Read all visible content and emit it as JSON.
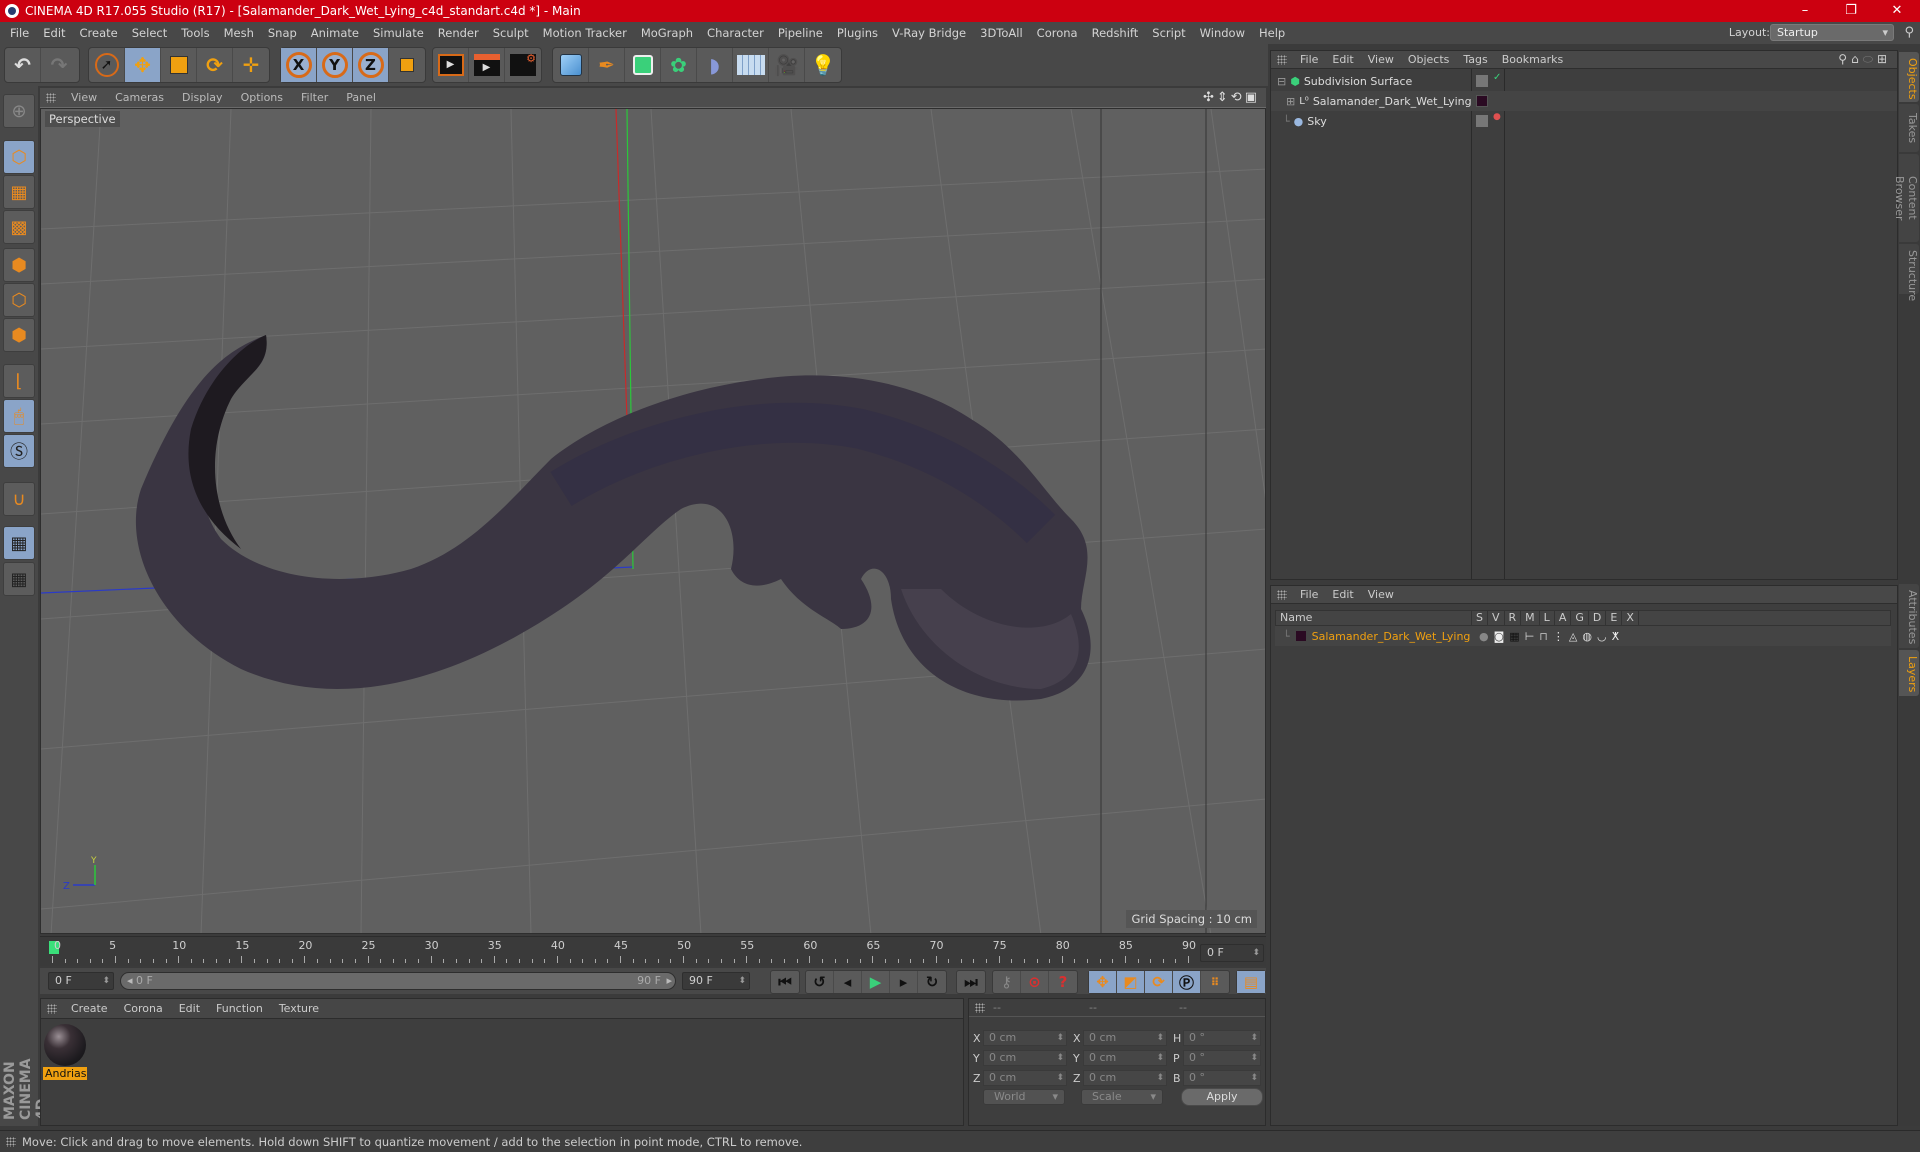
{
  "window": {
    "title": "CINEMA 4D R17.055 Studio (R17) - [Salamander_Dark_Wet_Lying_c4d_standart.c4d *] - Main",
    "controls": {
      "minimize": "–",
      "restore": "❐",
      "close": "✕"
    }
  },
  "menubar": {
    "items": [
      "File",
      "Edit",
      "Create",
      "Select",
      "Tools",
      "Mesh",
      "Snap",
      "Animate",
      "Simulate",
      "Render",
      "Sculpt",
      "Motion Tracker",
      "MoGraph",
      "Character",
      "Pipeline",
      "Plugins",
      "V-Ray Bridge",
      "3DToAll",
      "Corona",
      "Redshift",
      "Script",
      "Window",
      "Help"
    ],
    "layout_label": "Layout:",
    "layout_value": "Startup"
  },
  "toolbar": {
    "groups": [
      {
        "name": "history",
        "tools": [
          "undo-icon",
          "redo-icon"
        ]
      },
      {
        "name": "transform",
        "tools": [
          "live-select-icon",
          "move-icon",
          "scale-icon",
          "rotate-icon",
          "move-axis-icon"
        ]
      },
      {
        "name": "axis-lock",
        "tools": [
          "x-axis-icon",
          "y-axis-icon",
          "z-axis-icon",
          "coordinate-system-icon"
        ]
      },
      {
        "name": "render",
        "tools": [
          "render-view-icon",
          "render-picture-viewer-icon",
          "render-settings-icon"
        ]
      },
      {
        "name": "objects",
        "tools": [
          "cube-icon",
          "pen-spline-icon",
          "subdivision-surface-icon",
          "cloner-icon",
          "deformer-icon",
          "floor-icon",
          "camera-icon",
          "light-icon"
        ]
      }
    ],
    "axis_labels": [
      "X",
      "Y",
      "Z"
    ]
  },
  "left_toolbar": {
    "tools": [
      "make-editable-icon",
      "model-mode-icon",
      "texture-mode-icon",
      "workplane-icon",
      "points-mode-icon",
      "edges-mode-icon",
      "polygons-mode-icon",
      "enable-axis-icon",
      "tweak-mode-icon",
      "solo-icon",
      "snap-icon",
      "workplane-lock-icon",
      "workplane-rotate-icon"
    ],
    "branding": "MAXON CINEMA 4D"
  },
  "viewport": {
    "menu": [
      "View",
      "Cameras",
      "Display",
      "Options",
      "Filter",
      "Panel"
    ],
    "camera_label": "Perspective",
    "grid_spacing": "Grid Spacing : 10 cm",
    "nav_icons": [
      "move-view-icon",
      "zoom-view-icon",
      "rotate-view-icon",
      "maximize-view-icon"
    ],
    "axis_gizmo": {
      "y": "Y",
      "z": "Z"
    }
  },
  "timeline": {
    "ticks": [
      "0",
      "5",
      "10",
      "15",
      "20",
      "25",
      "30",
      "35",
      "40",
      "45",
      "50",
      "55",
      "60",
      "65",
      "70",
      "75",
      "80",
      "85",
      "90"
    ],
    "current_frame": "0 F",
    "start_field": "0 F",
    "range_start": "0 F",
    "range_end": "90 F",
    "end_field": "90 F",
    "current_position": 0,
    "max_frame": 90
  },
  "playback": {
    "buttons": [
      "go-to-start-icon",
      "previous-key-icon",
      "previous-frame-icon",
      "play-icon",
      "next-frame-icon",
      "next-key-icon",
      "go-to-end-icon"
    ],
    "record_buttons": [
      "keyframe-selection-icon",
      "autokey-icon",
      "record-help-icon"
    ],
    "key_buttons": [
      "key-position-icon",
      "key-scale-icon",
      "key-rotation-icon",
      "key-parameter-icon",
      "key-pla-icon"
    ],
    "timeline_button": "timeline-window-icon"
  },
  "materials": {
    "menu": [
      "Create",
      "Corona",
      "Edit",
      "Function",
      "Texture"
    ],
    "items": [
      {
        "name": "Andrias"
      }
    ]
  },
  "coordinates": {
    "headers": [
      "--",
      "--",
      "--"
    ],
    "rows": [
      {
        "l1": "X",
        "v1": "0 cm",
        "l2": "X",
        "v2": "0 cm",
        "l3": "H",
        "v3": "0 °"
      },
      {
        "l1": "Y",
        "v1": "0 cm",
        "l2": "Y",
        "v2": "0 cm",
        "l3": "P",
        "v3": "0 °"
      },
      {
        "l1": "Z",
        "v1": "0 cm",
        "l2": "Z",
        "v2": "0 cm",
        "l3": "B",
        "v3": "0 °"
      }
    ],
    "space_select": "World",
    "mode_select": "Scale",
    "apply_label": "Apply"
  },
  "object_manager": {
    "menu": [
      "File",
      "Edit",
      "View",
      "Objects",
      "Tags",
      "Bookmarks"
    ],
    "objects": [
      {
        "name": "Subdivision Surface",
        "icon": "subdivision-surface-icon",
        "enabled": "✓"
      },
      {
        "name": "Salamander_Dark_Wet_Lying",
        "icon": "null-object-icon",
        "layer_color": "#2a0a22"
      },
      {
        "name": "Sky",
        "icon": "sky-icon"
      }
    ]
  },
  "layer_manager": {
    "menu": [
      "File",
      "Edit",
      "View"
    ],
    "columns": [
      "Name",
      "S",
      "V",
      "R",
      "M",
      "L",
      "A",
      "G",
      "D",
      "E",
      "X"
    ],
    "layers": [
      {
        "name": "Salamander_Dark_Wet_Lying",
        "color": "#2a0a22"
      }
    ]
  },
  "right_tabs": {
    "top": [
      {
        "label": "Objects",
        "active": true
      },
      {
        "label": "Takes",
        "active": false
      },
      {
        "label": "Content Browser",
        "active": false
      },
      {
        "label": "Structure",
        "active": false
      }
    ],
    "bottom": [
      {
        "label": "Attributes",
        "active": false
      },
      {
        "label": "Layers",
        "active": true
      }
    ]
  },
  "status": {
    "text": "Move: Click and drag to move elements. Hold down SHIFT to quantize movement / add to the selection in point mode, CTRL to remove."
  },
  "colors": {
    "titlebar": "#cc0010",
    "accent_orange": "#f0a010",
    "active_tool": "#8aa4c8",
    "frame_marker": "#3adf7a"
  }
}
